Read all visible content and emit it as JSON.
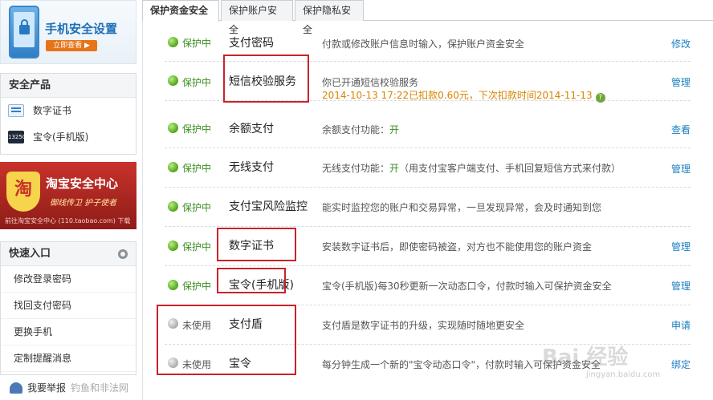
{
  "sidebar": {
    "phone_banner": {
      "title": "手机安全设置",
      "button": "立即查看 ▶"
    },
    "security_products": {
      "heading": "安全产品",
      "items": [
        {
          "label": "数字证书",
          "icon": "certificate-icon"
        },
        {
          "label": "宝令(手机版)",
          "icon": "token-icon",
          "icon_text": "13250"
        }
      ]
    },
    "taobao_banner": {
      "title": "淘宝安全中心",
      "badge": "淘",
      "slogan": "御线传卫  护子使者",
      "footer": "前往淘宝安全中心 (110.taobao.com) 下载"
    },
    "quick_entry": {
      "heading": "快速入口",
      "items": [
        "修改登录密码",
        "找回支付密码",
        "更换手机",
        "定制提醒消息"
      ]
    },
    "report": {
      "label": "我要举报",
      "sub": "钓鱼和非法网"
    }
  },
  "tabs": [
    {
      "label": "保护资金安全",
      "active": true
    },
    {
      "label": "保护账户安全",
      "active": false
    },
    {
      "label": "保护隐私安全",
      "active": false
    }
  ],
  "rows": [
    {
      "status": "保护中",
      "active": true,
      "name": "支付密码",
      "desc": "付款或修改账户信息时输入，保护账户资金安全",
      "action": "修改"
    },
    {
      "status": "保护中",
      "active": true,
      "name": "短信校验服务",
      "desc": "你已开通短信校验服务",
      "desc_line2": "2014-10-13 17:22已扣款0.60元，下次扣款时间2014-11-13",
      "action": "管理"
    },
    {
      "status": "保护中",
      "active": true,
      "name": "余额支付",
      "desc_prefix": "余额支付功能：",
      "desc_value": "开",
      "action": "查看"
    },
    {
      "status": "保护中",
      "active": true,
      "name": "无线支付",
      "desc_prefix": "无线支付功能：",
      "desc_value": "开",
      "desc_suffix": "（用支付宝客户端支付、手机回复短信方式来付款）",
      "action": "管理"
    },
    {
      "status": "保护中",
      "active": true,
      "name": "支付宝风险监控",
      "desc": "能实时监控您的账户和交易异常，一旦发现异常，会及时通知到您",
      "action": ""
    },
    {
      "status": "保护中",
      "active": true,
      "name": "数字证书",
      "desc": "安装数字证书后，即使密码被盗，对方也不能使用您的账户资金",
      "action": "管理"
    },
    {
      "status": "保护中",
      "active": true,
      "name": "宝令(手机版)",
      "desc": "宝令(手机版)每30秒更新一次动态口令，付款时输入可保护资金安全",
      "action": "管理"
    },
    {
      "status": "未使用",
      "active": false,
      "name": "支付盾",
      "desc": "支付盾是数字证书的升级，实现随时随地更安全",
      "action": "申请"
    },
    {
      "status": "未使用",
      "active": false,
      "name": "宝令",
      "desc": "每分钟生成一个新的\"宝令动态口令\"，付款时输入可保护资金安全",
      "action": "绑定"
    }
  ],
  "watermark": {
    "text": "Bai 经验",
    "sub": "jingyan.baidu.com"
  },
  "colors": {
    "protect_green": "#3a8f1e",
    "link_blue": "#1a7ec1",
    "highlight_red": "#c8232b",
    "deduct_orange": "#d98500"
  }
}
